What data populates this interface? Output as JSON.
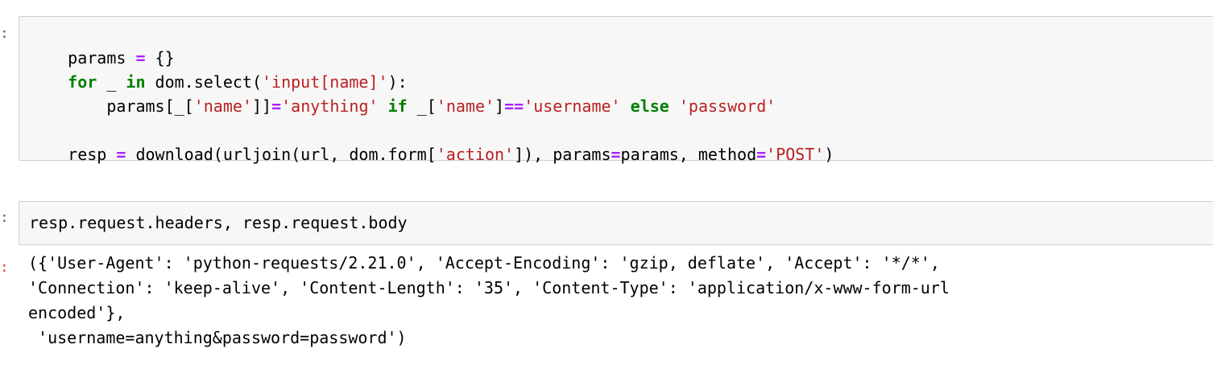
{
  "prompt_in": ":",
  "prompt_out": ":",
  "cell1": {
    "l1": {
      "a": "params ",
      "b": "=",
      "c": " {}"
    },
    "l2": {
      "a": "for",
      "b": " _ ",
      "c": "in",
      "d": " dom.select(",
      "e": "'input[name]'",
      "f": "):"
    },
    "l3": {
      "a": "    params[_[",
      "b": "'name'",
      "c": "]]",
      "d": "=",
      "e": "'anything'",
      "f": " ",
      "g": "if",
      "h": " _[",
      "i": "'name'",
      "j": "]",
      "k": "==",
      "l": "'username'",
      "m": " ",
      "n": "else",
      "o": " ",
      "p": "'password'"
    },
    "l5": {
      "a": "resp ",
      "b": "=",
      "c": " download(urljoin(url, dom.form[",
      "d": "'action'",
      "e": "]), params",
      "f": "=",
      "g": "params, method",
      "h": "=",
      "i": "'POST'",
      "j": ")"
    }
  },
  "cell2": {
    "l1": "resp.request.headers, resp.request.body"
  },
  "output": {
    "lines": [
      "({'User-Agent': 'python-requests/2.21.0', 'Accept-Encoding': 'gzip, deflate', 'Accept': '*/*',",
      "'Connection': 'keep-alive', 'Content-Length': '35', 'Content-Type': 'application/x-www-form-url",
      "encoded'},",
      " 'username=anything&password=password')"
    ]
  }
}
